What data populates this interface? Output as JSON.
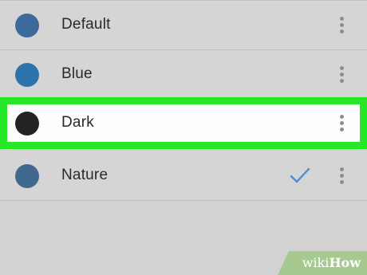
{
  "themes": [
    {
      "label": "Default",
      "color": "#3d6a9c",
      "selected": false,
      "highlighted": false
    },
    {
      "label": "Blue",
      "color": "#2d74ad",
      "selected": false,
      "highlighted": false
    },
    {
      "label": "Dark",
      "color": "#232323",
      "selected": false,
      "highlighted": true
    },
    {
      "label": "Nature",
      "color": "#41688f",
      "selected": true,
      "highlighted": false
    }
  ],
  "colors": {
    "highlight_border": "#27e827",
    "check": "#4f8fd1",
    "background": "#d2d2d2"
  },
  "watermark": {
    "wiki": "wiki",
    "how": "How"
  }
}
